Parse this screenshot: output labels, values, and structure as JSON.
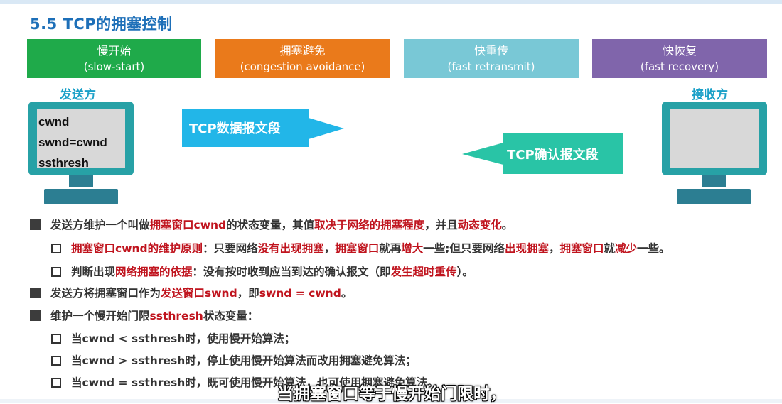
{
  "slide": {
    "title": "5.5 TCP的拥塞控制"
  },
  "phases": [
    {
      "cn": "慢开始",
      "en": "(slow-start)",
      "color": "#1faa4a"
    },
    {
      "cn": "拥塞避免",
      "en": "(congestion avoidance)",
      "color": "#ea7a1b"
    },
    {
      "cn": "快重传",
      "en": "(fast retransmit)",
      "color": "#79c8d6"
    },
    {
      "cn": "快恢复",
      "en": "(fast recovery)",
      "color": "#8065ab"
    }
  ],
  "sender": {
    "label": "发送方",
    "vars": [
      "cwnd",
      "swnd=cwnd",
      "ssthresh"
    ]
  },
  "receiver": {
    "label": "接收方"
  },
  "segments": {
    "data": "TCP数据报文段",
    "ack": "TCP确认报文段"
  },
  "bullets": {
    "b1": {
      "p1": "发送方维护一个叫做",
      "r1": "拥塞窗口cwnd",
      "p2": "的状态变量，其值",
      "r2": "取决于网络的拥塞程度",
      "p3": "，并且",
      "r3": "动态变化",
      "p4": "。"
    },
    "s1": {
      "r1": "拥塞窗口",
      "p1": "",
      "r2": "cwnd的维护原则",
      "p2": "：只要网络",
      "r3": "没有出现拥塞",
      "p3": "，",
      "r4": "拥塞窗口",
      "p4": "就再",
      "r5": "增大",
      "p5": "一些;但只要网络",
      "r6": "出现拥塞",
      "p6": "，",
      "r7": "拥塞窗口",
      "p7": "就",
      "r8": "减少",
      "p8": "一些。"
    },
    "s2": {
      "p1": "判断出现",
      "r1": "网络拥塞的依据",
      "p2": "：没有按时收到应当到达的确认报文（即",
      "r2": "发生超时重传",
      "p3": "）。"
    },
    "b2": {
      "p1": "发送方将拥塞窗口作为",
      "r1": "发送窗口swnd",
      "p2": "，即",
      "r2": "swnd = cwnd",
      "p3": "。"
    },
    "b3": {
      "p1": "维护一个慢开始门限",
      "r1": "ssthresh",
      "p2": "状态变量："
    },
    "c1": "当cwnd < ssthresh时，使用慢开始算法；",
    "c2": "当cwnd > ssthresh时，停止使用慢开始算法而改用拥塞避免算法；",
    "c3": "当cwnd = ssthresh时，既可使用慢开始算法，也可使用拥塞避免算法。"
  },
  "subtitle": "当拥塞窗口等于慢开始门限时，"
}
